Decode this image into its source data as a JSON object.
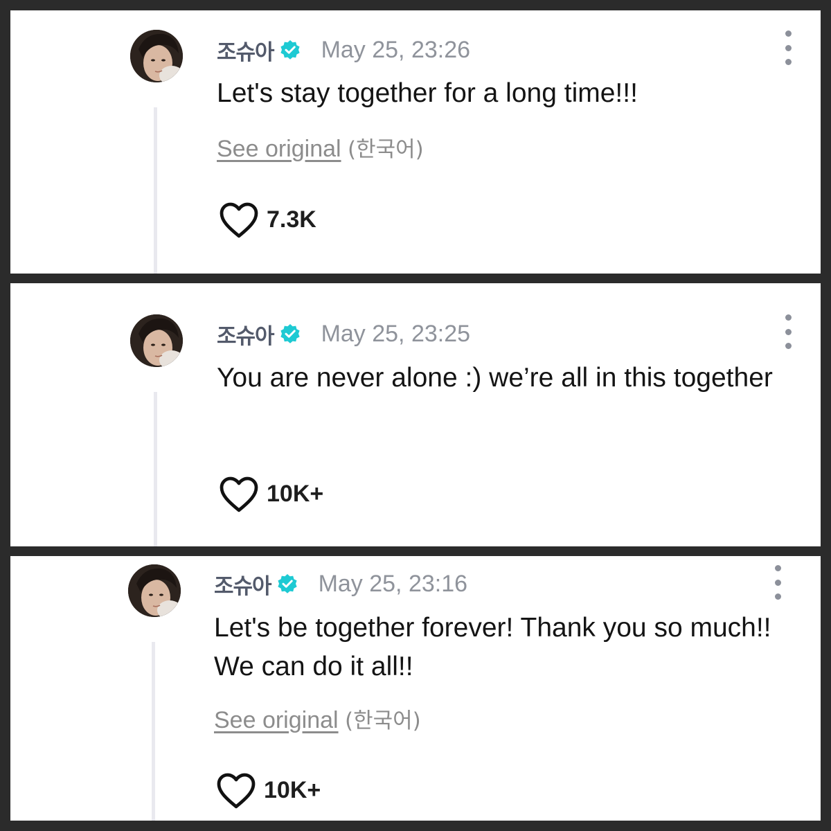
{
  "posts": [
    {
      "author": "조슈아",
      "timestamp": "May 25, 23:26",
      "text": "Let's stay together for a long time!!!",
      "see_original": "See original",
      "original_language": "(한국어)",
      "likes": "7.3K"
    },
    {
      "author": "조슈아",
      "timestamp": "May 25, 23:25",
      "text": "You are never alone :) we’re all in this together",
      "likes": "10K+"
    },
    {
      "author": "조슈아",
      "timestamp": "May 25, 23:16",
      "text": "Let's be together forever! Thank you so much!! We can do it all!!",
      "see_original": "See original",
      "original_language": "(한국어)",
      "likes": "10K+"
    }
  ],
  "colors": {
    "verified_badge": "#1ecad3",
    "author": "#535a6b",
    "timestamp": "#8f939b",
    "thread_line": "#e9e9ef",
    "border": "#2b2b2b"
  },
  "icons": {
    "verified": "verified-badge-icon",
    "like": "heart-outline-icon",
    "more": "more-vertical-icon"
  }
}
